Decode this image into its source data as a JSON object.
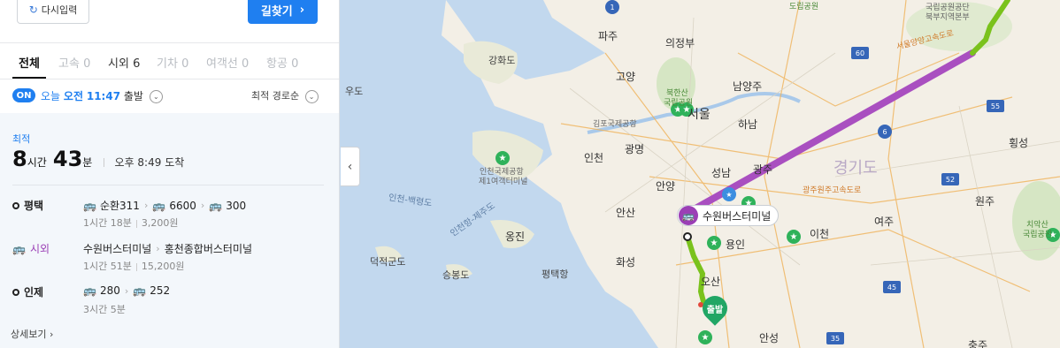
{
  "toolbar": {
    "reset_label": "다시입력",
    "search_label": "길찾기"
  },
  "tabs": [
    {
      "label": "전체",
      "count": ""
    },
    {
      "label": "고속",
      "count": "0"
    },
    {
      "label": "시외",
      "count": "6"
    },
    {
      "label": "기차",
      "count": "0"
    },
    {
      "label": "여객선",
      "count": "0"
    },
    {
      "label": "항공",
      "count": "0"
    }
  ],
  "departure": {
    "badge": "ON",
    "day": "오늘",
    "ampm": "오전",
    "time": "11:47",
    "suffix": "출발",
    "sort": "최적 경로순"
  },
  "result": {
    "label": "최적",
    "hours": "8",
    "hours_unit": "시간",
    "minutes": "43",
    "minutes_unit": "분",
    "arrival": "오후 8:49 도착",
    "legs": [
      {
        "name": "평택",
        "routes": [
          "순환311",
          "6600",
          "300"
        ],
        "duration": "1시간 18분",
        "fare": "3,200원"
      },
      {
        "name": "시외",
        "routes": [
          "수원버스터미널",
          "홍천종합버스터미널"
        ],
        "duration": "1시간 51분",
        "fare": "15,200원"
      },
      {
        "name": "인제",
        "routes": [
          "280",
          "252"
        ],
        "duration": "3시간 5분",
        "fare": ""
      }
    ],
    "detail_link": "상세보기"
  },
  "map": {
    "terminal_label": "수원버스터미널",
    "start_label": "출발",
    "labels": {
      "paju": "파주",
      "uijeongbu": "의정부",
      "goyang": "고양",
      "namyangju": "남양주",
      "seoul": "서울",
      "hanam": "하남",
      "gwangmyeong": "광명",
      "incheon": "인천",
      "seongnam": "성남",
      "gwangju": "광주",
      "gyeonggido": "경기도",
      "anyang": "안양",
      "ansan": "안산",
      "yongin": "용인",
      "icheon": "이천",
      "yeoju": "여주",
      "hwaseong": "화성",
      "osan": "오산",
      "anseong": "안성",
      "yongjin": "옹진",
      "ganghwado": "강화도",
      "udo": "우도",
      "wonju": "원주",
      "hoengseong": "횡성",
      "chungju": "충주",
      "deokjeokgundo": "덕적군도",
      "seunghwangdo": "승봉도",
      "pyeongtaekport": "평택항",
      "gimpo_airport": "김포국제공항",
      "incheon_airport_1": "인천국제공항",
      "incheon_airport_2": "제1여객터미널",
      "bukhansan_1": "북한산",
      "bukhansan_2": "국립공원",
      "chiak_1": "치악산",
      "chiak_2": "국립공원",
      "dorim": "도립공원",
      "nat_park_1": "국립공원공단",
      "nat_park_2": "북부지역본부",
      "sea_route_1": "인천-백령도",
      "sea_route_2": "인천항-제주도",
      "expwy_seoul_yangyang": "서울양양고속도로",
      "expwy_gwangju_wonju": "광주원주고속도로",
      "hwy_60": "60",
      "hwy_55": "55",
      "hwy_6": "6",
      "hwy_52": "52",
      "hwy_45": "45",
      "hwy_35": "35",
      "hwy_1": "1"
    }
  },
  "colors": {
    "accent": "#1f7ff0",
    "bus_green": "#46b334",
    "bus_red": "#e2473a",
    "intercity": "#9b3fb5",
    "route_line": "#a94fc0",
    "route_green": "#7ac21c"
  },
  "icons": {
    "reset": "refresh-icon",
    "search_chevron": "chevron-right-icon",
    "bus": "bus-icon"
  }
}
